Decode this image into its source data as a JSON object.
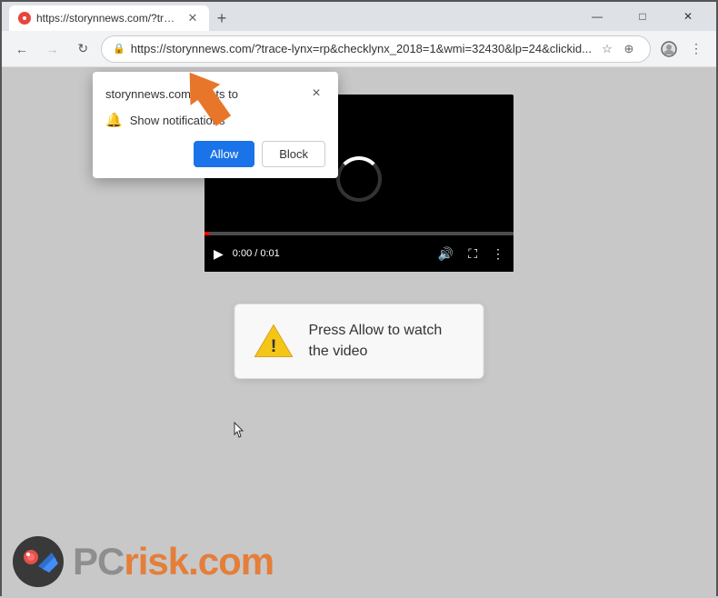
{
  "titlebar": {
    "tab_title": "https://storynnews.com/?trace-ly...",
    "favicon": "🔴",
    "new_tab_label": "+",
    "minimize": "—",
    "maximize": "□",
    "close": "✕"
  },
  "navbar": {
    "back": "←",
    "forward": "→",
    "refresh": "↻",
    "address": "https://storynnews.com/?trace-lynx=rp&checklynx_2018=1&wmi=32430&lp=24&clickid...",
    "lock": "🔒",
    "star": "☆",
    "extensions": "⊕",
    "profile": "👤",
    "menu": "⋮"
  },
  "popup": {
    "title": "storynnews.com wants to",
    "permission_label": "Show notifications",
    "allow_label": "Allow",
    "block_label": "Block",
    "close": "×"
  },
  "video": {
    "time": "0:00 / 0:01"
  },
  "message": {
    "text": "Press Allow to watch the video"
  },
  "watermark": {
    "pc": "PC",
    "risk": "risk.com"
  }
}
